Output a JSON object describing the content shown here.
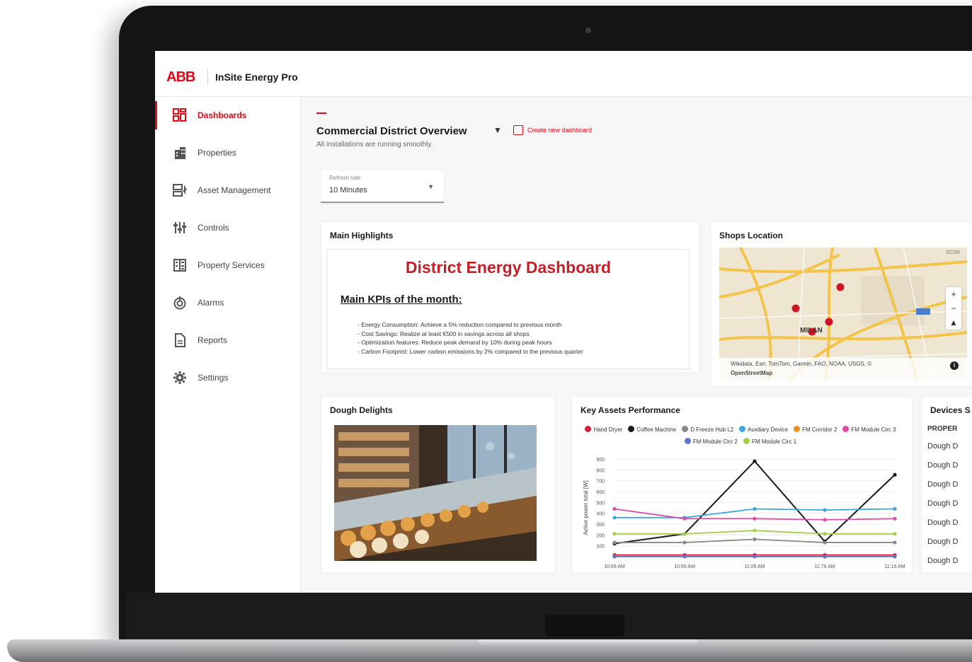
{
  "app": {
    "logo": "ABB",
    "title": "InSite Energy Pro"
  },
  "sidebar": {
    "items": [
      {
        "label": "Dashboards",
        "icon": "dashboard-icon"
      },
      {
        "label": "Properties",
        "icon": "building-icon"
      },
      {
        "label": "Asset Management",
        "icon": "asset-icon"
      },
      {
        "label": "Controls",
        "icon": "sliders-icon"
      },
      {
        "label": "Property Services",
        "icon": "property-services-icon"
      },
      {
        "label": "Alarms",
        "icon": "alarm-icon"
      },
      {
        "label": "Reports",
        "icon": "report-icon"
      },
      {
        "label": "Settings",
        "icon": "gear-icon"
      }
    ],
    "collapse_label": "‹"
  },
  "header": {
    "title": "Commercial District Overview",
    "create_label": "Create new dashboard",
    "subtitle": "All installations are running smoothly."
  },
  "refresh": {
    "label": "Refresh rate",
    "value": "10 Minutes"
  },
  "highlights": {
    "title": "Main Highlights",
    "heading": "District Energy Dashboard",
    "kpi_title": "Main KPIs of the month:",
    "items": [
      "- Energy Consumption: Achieve a 5% reduction compared to previous month",
      "- Cost Savings: Realize at least €500 in savings across all shops",
      "- Optimization features: Reduce peak demand by 10% during peak hours",
      "- Carbon Footprint: Lower carbon emissions by 2% compared to the previous quarter"
    ]
  },
  "shops": {
    "title": "Shops Location",
    "city_label": "MILAN",
    "corner_label": "SCOR.",
    "attribution": "Wikidata, Esri, TomTom, Garmin, FAO, NOAA, USGS, ©",
    "attribution2": "OpenStreetMap",
    "zoom_in": "+",
    "zoom_out": "−",
    "compass": "▲"
  },
  "dough": {
    "title": "Dough Delights"
  },
  "devices": {
    "title": "Devices S",
    "header": "PROPER",
    "rows": [
      "Dough D",
      "Dough D",
      "Dough D",
      "Dough D",
      "Dough D",
      "Dough D",
      "Dough D"
    ]
  },
  "colors": {
    "accent": "#e30613"
  },
  "chart_data": {
    "type": "line",
    "title": "Key Assets Performance",
    "ylabel": "Active power total [W]",
    "xlabel": "",
    "x": [
      "10:56 AM",
      "10:66 AM",
      "11:06 AM",
      "11:76 AM",
      "11:16 AM"
    ],
    "ylim": [
      0,
      900
    ],
    "yticks": [
      100,
      200,
      300,
      400,
      500,
      600,
      700,
      800,
      900
    ],
    "grid": true,
    "legend_position": "top",
    "series": [
      {
        "name": "Hand Dryer",
        "color": "#d71e3a",
        "values": [
          15,
          15,
          15,
          15,
          15
        ]
      },
      {
        "name": "Coffee Machine",
        "color": "#1a1a1a",
        "values": [
          120,
          210,
          880,
          140,
          755
        ]
      },
      {
        "name": "D Freeze Hub L2",
        "color": "#888888",
        "values": [
          130,
          130,
          160,
          130,
          130
        ]
      },
      {
        "name": "Auxiliary Device",
        "color": "#3aa8dc",
        "values": [
          360,
          360,
          440,
          430,
          440
        ]
      },
      {
        "name": "FM Corridor 2",
        "color": "#f28c1c",
        "values": [
          0,
          0,
          0,
          0,
          0
        ]
      },
      {
        "name": "FM Module Circ 3",
        "color": "#e04aa8",
        "values": [
          440,
          350,
          350,
          340,
          350
        ]
      },
      {
        "name": "FM Module Circ 2",
        "color": "#5a78c8",
        "values": [
          0,
          0,
          0,
          0,
          0
        ]
      },
      {
        "name": "FM Module Circ 1",
        "color": "#a4cf4a",
        "values": [
          210,
          210,
          240,
          210,
          210
        ]
      }
    ]
  }
}
